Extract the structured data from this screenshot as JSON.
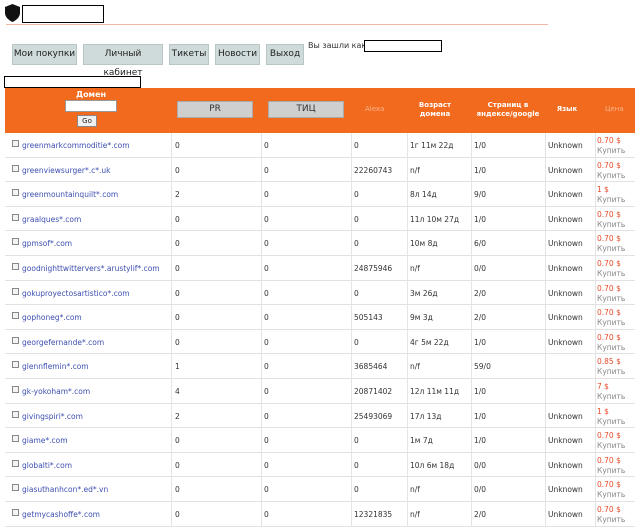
{
  "header": {
    "logo_icon": "shield-icon"
  },
  "nav": {
    "items": [
      {
        "label": "Мои покупки"
      },
      {
        "label": "Личный кабинет"
      },
      {
        "label": "Тикеты"
      },
      {
        "label": "Новости"
      },
      {
        "label": "Выход"
      }
    ],
    "login_label": "Вы зашли как:"
  },
  "table": {
    "headers": {
      "domain": "Домен",
      "go": "Go",
      "pr": "PR",
      "tic": "ТИЦ",
      "alexa": "Alexa",
      "age": "Возраст домена",
      "pages": "Страниц в яндексе/google",
      "lang": "Язык",
      "price": "Цена"
    },
    "buy_label": "Купить",
    "rows": [
      {
        "domain": "greenmarkcommoditie*.com",
        "pr": "0",
        "tic": "0",
        "alexa": "0",
        "age": "1г 11м 22д",
        "pages": "1/0",
        "lang": "Unknown",
        "price": "0.70 $"
      },
      {
        "domain": "greenviewsurger*.c*.uk",
        "pr": "0",
        "tic": "0",
        "alexa": "22260743",
        "age": "n/f",
        "pages": "1/0",
        "lang": "Unknown",
        "price": "0.70 $"
      },
      {
        "domain": "greenmountainquilt*.com",
        "pr": "2",
        "tic": "0",
        "alexa": "0",
        "age": "8л 14д",
        "pages": "9/0",
        "lang": "Unknown",
        "price": "1 $"
      },
      {
        "domain": "graalques*.com",
        "pr": "0",
        "tic": "0",
        "alexa": "0",
        "age": "11л 10м 27д",
        "pages": "1/0",
        "lang": "Unknown",
        "price": "0.70 $"
      },
      {
        "domain": "gpmsof*.com",
        "pr": "0",
        "tic": "0",
        "alexa": "0",
        "age": "10м 8д",
        "pages": "6/0",
        "lang": "Unknown",
        "price": "0.70 $"
      },
      {
        "domain": "goodnighttwittervers*.arustylif*.com",
        "pr": "0",
        "tic": "0",
        "alexa": "24875946",
        "age": "n/f",
        "pages": "0/0",
        "lang": "Unknown",
        "price": "0.70 $"
      },
      {
        "domain": "gokuproyectosartistico*.com",
        "pr": "0",
        "tic": "0",
        "alexa": "0",
        "age": "3м 26д",
        "pages": "2/0",
        "lang": "Unknown",
        "price": "0.70 $"
      },
      {
        "domain": "gophoneg*.com",
        "pr": "0",
        "tic": "0",
        "alexa": "505143",
        "age": "9м 3д",
        "pages": "2/0",
        "lang": "Unknown",
        "price": "0.70 $"
      },
      {
        "domain": "georgefernande*.com",
        "pr": "0",
        "tic": "0",
        "alexa": "0",
        "age": "4г 5м 22д",
        "pages": "1/0",
        "lang": "Unknown",
        "price": "0.70 $"
      },
      {
        "domain": "glennflemin*.com",
        "pr": "1",
        "tic": "0",
        "alexa": "3685464",
        "age": "n/f",
        "pages": "59/0",
        "lang": "",
        "price": "0.85 $"
      },
      {
        "domain": "gk-yokoham*.com",
        "pr": "4",
        "tic": "0",
        "alexa": "20871402",
        "age": "12л 11м 11д",
        "pages": "1/0",
        "lang": "",
        "price": "7 $"
      },
      {
        "domain": "givingspiri*.com",
        "pr": "2",
        "tic": "0",
        "alexa": "25493069",
        "age": "17л 13д",
        "pages": "1/0",
        "lang": "Unknown",
        "price": "1 $"
      },
      {
        "domain": "giame*.com",
        "pr": "0",
        "tic": "0",
        "alexa": "0",
        "age": "1м 7д",
        "pages": "1/0",
        "lang": "Unknown",
        "price": "0.70 $"
      },
      {
        "domain": "globalti*.com",
        "pr": "0",
        "tic": "0",
        "alexa": "0",
        "age": "10л 6м 18д",
        "pages": "0/0",
        "lang": "Unknown",
        "price": "0.70 $"
      },
      {
        "domain": "giasuthanhcon*.ed*.vn",
        "pr": "0",
        "tic": "0",
        "alexa": "0",
        "age": "n/f",
        "pages": "0/0",
        "lang": "Unknown",
        "price": "0.70 $"
      },
      {
        "domain": "getmycashoffe*.com",
        "pr": "0",
        "tic": "0",
        "alexa": "12321835",
        "age": "n/f",
        "pages": "2/0",
        "lang": "Unknown",
        "price": "0.70 $"
      }
    ]
  },
  "colors": {
    "accent": "#f26a1e",
    "link": "#3d4fb0",
    "price": "#e84a2a"
  }
}
